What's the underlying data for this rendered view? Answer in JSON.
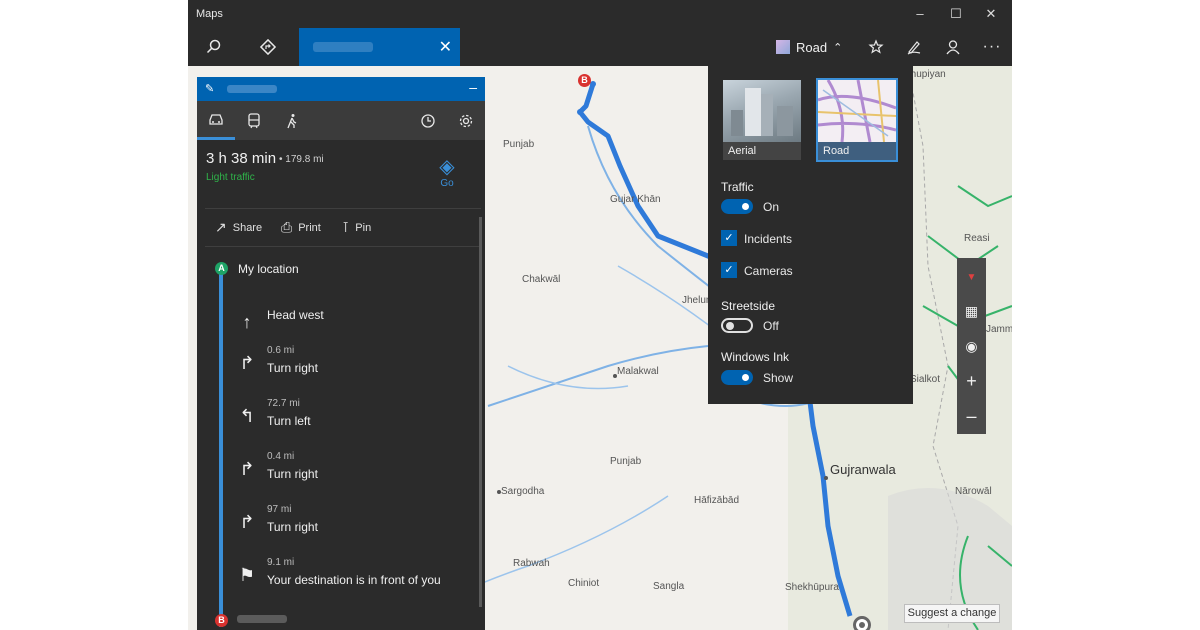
{
  "app": {
    "title": "Maps"
  },
  "toolbar": {
    "road_label": "Road"
  },
  "directions": {
    "summary": {
      "time": "3 h 38 min",
      "distance": "• 179.8 mi",
      "traffic": "Light traffic",
      "go_label": "Go"
    },
    "actions": {
      "share": "Share",
      "print": "Print",
      "pin": "Pin"
    },
    "start_label": "My location",
    "pin_a": "A",
    "pin_b": "B",
    "steps": [
      {
        "dist": "",
        "instr": "Head west",
        "icon": "arrow-up-icon"
      },
      {
        "dist": "0.6 mi",
        "instr": "Turn right",
        "icon": "turn-right-icon"
      },
      {
        "dist": "72.7 mi",
        "instr": "Turn left",
        "icon": "turn-left-icon"
      },
      {
        "dist": "0.4 mi",
        "instr": "Turn right",
        "icon": "turn-right-icon"
      },
      {
        "dist": "97 mi",
        "instr": "Turn right",
        "icon": "turn-right-icon"
      },
      {
        "dist": "9.1 mi",
        "instr": "Your destination is in front of you",
        "icon": "flag-icon"
      }
    ]
  },
  "layers": {
    "aerial": "Aerial",
    "road": "Road",
    "traffic": {
      "label": "Traffic",
      "state": "On"
    },
    "incidents": "Incidents",
    "cameras": "Cameras",
    "streetside": {
      "label": "Streetside",
      "state": "Off"
    },
    "ink": {
      "label": "Windows Ink",
      "state": "Show"
    }
  },
  "map": {
    "labels": {
      "shupiyan": "Shupiyan",
      "punjab1": "Punjab",
      "gujar_khan": "Gujar Khān",
      "chakwal": "Chakwāl",
      "jhelum": "Jhelum",
      "reasi": "Reasi",
      "jammu": "Jammu",
      "malakwal": "Malakwal",
      "sialkot": "Sialkot",
      "gujranwala": "Gujranwala",
      "punjab2": "Punjab",
      "sargodha": "Sargodha",
      "hafizabad": "Hāfizābād",
      "narowal": "Nārowāl",
      "rabwah": "Rabwah",
      "chiniot": "Chiniot",
      "sangla": "Sangla",
      "sheikhupura": "Shekhūpura",
      "pin_b": "B"
    },
    "suggest": "Suggest a change"
  },
  "colors": {
    "accent": "#0063b1",
    "route": "#2f7ad9",
    "traffic_green": "#2fb34a"
  }
}
